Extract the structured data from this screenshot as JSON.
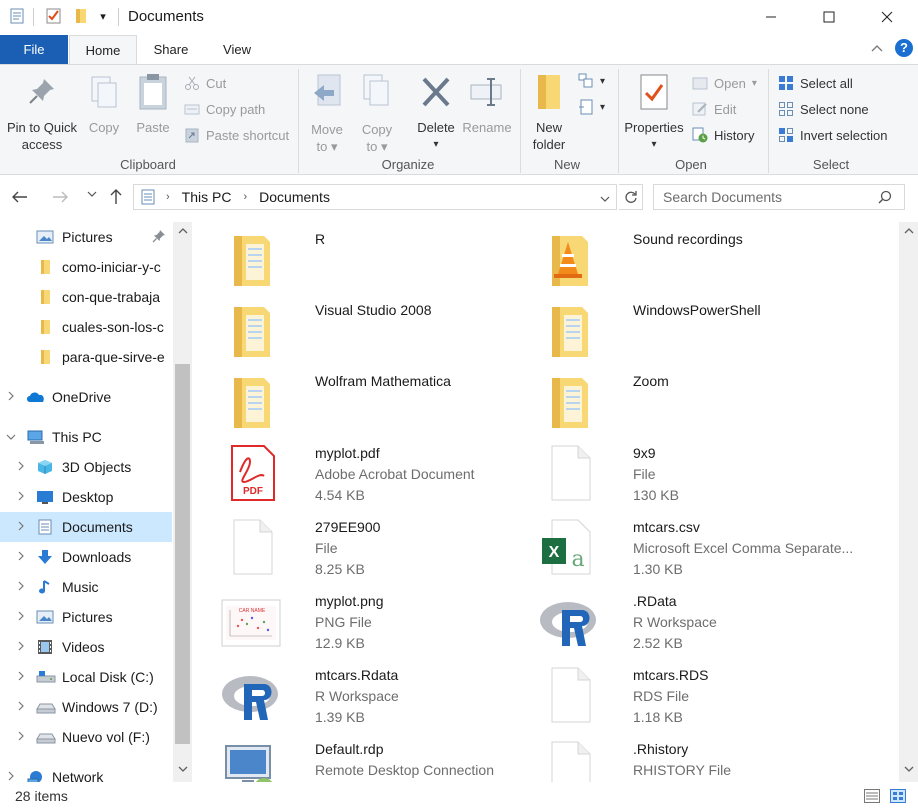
{
  "window": {
    "title": "Documents",
    "quick_access_dropdown": "▾"
  },
  "tabs": {
    "file": "File",
    "home": "Home",
    "share": "Share",
    "view": "View"
  },
  "ribbon": {
    "clipboard": {
      "label": "Clipboard",
      "pin": "Pin to Quick access",
      "pin_line1": "Pin to Quick",
      "pin_line2": "access",
      "copy": "Copy",
      "paste": "Paste",
      "cut": "Cut",
      "copy_path": "Copy path",
      "paste_shortcut": "Paste shortcut"
    },
    "organize": {
      "label": "Organize",
      "move_to_line1": "Move",
      "move_to_line2": "to",
      "copy_to_line1": "Copy",
      "copy_to_line2": "to",
      "delete": "Delete",
      "rename": "Rename"
    },
    "new": {
      "label": "New",
      "new_folder_line1": "New",
      "new_folder_line2": "folder"
    },
    "open": {
      "label": "Open",
      "properties": "Properties",
      "open": "Open",
      "edit": "Edit",
      "history": "History"
    },
    "select": {
      "label": "Select",
      "select_all": "Select all",
      "select_none": "Select none",
      "invert": "Invert selection"
    }
  },
  "address": {
    "crumbs": [
      "This PC",
      "Documents"
    ],
    "search_placeholder": "Search Documents"
  },
  "nav": {
    "items": [
      {
        "label": "Pictures",
        "icon": "pictures-icon",
        "pinned": true
      },
      {
        "label": "como-iniciar-y-c",
        "icon": "folder-icon"
      },
      {
        "label": "con-que-trabaja",
        "icon": "folder-icon"
      },
      {
        "label": "cuales-son-los-c",
        "icon": "folder-icon"
      },
      {
        "label": "para-que-sirve-e",
        "icon": "folder-icon"
      },
      {
        "label": "OneDrive",
        "icon": "onedrive-icon"
      },
      {
        "label": "This PC",
        "icon": "this-pc-icon"
      },
      {
        "label": "3D Objects",
        "icon": "3d-objects-icon"
      },
      {
        "label": "Desktop",
        "icon": "desktop-icon"
      },
      {
        "label": "Documents",
        "icon": "documents-icon",
        "selected": true
      },
      {
        "label": "Downloads",
        "icon": "downloads-icon"
      },
      {
        "label": "Music",
        "icon": "music-icon"
      },
      {
        "label": "Pictures",
        "icon": "pictures-icon"
      },
      {
        "label": "Videos",
        "icon": "videos-icon"
      },
      {
        "label": "Local Disk (C:)",
        "icon": "local-disk-icon"
      },
      {
        "label": "Windows 7 (D:)",
        "icon": "drive-icon"
      },
      {
        "label": "Nuevo vol (F:)",
        "icon": "drive-icon"
      },
      {
        "label": "Network",
        "icon": "network-icon"
      }
    ]
  },
  "files": [
    {
      "name": "R",
      "type": "",
      "size": "",
      "icon": "folder-icon"
    },
    {
      "name": "Sound recordings",
      "type": "",
      "size": "",
      "icon": "folder-vlc-icon"
    },
    {
      "name": "Visual Studio 2008",
      "type": "",
      "size": "",
      "icon": "folder-icon"
    },
    {
      "name": "WindowsPowerShell",
      "type": "",
      "size": "",
      "icon": "folder-icon"
    },
    {
      "name": "Wolfram Mathematica",
      "type": "",
      "size": "",
      "icon": "folder-icon"
    },
    {
      "name": "Zoom",
      "type": "",
      "size": "",
      "icon": "folder-icon"
    },
    {
      "name": "myplot.pdf",
      "type": "Adobe Acrobat Document",
      "size": "4.54 KB",
      "icon": "pdf-icon"
    },
    {
      "name": "9x9",
      "type": "File",
      "size": "130 KB",
      "icon": "blank-file-icon"
    },
    {
      "name": "279EE900",
      "type": "File",
      "size": "8.25 KB",
      "icon": "blank-file-icon"
    },
    {
      "name": "mtcars.csv",
      "type": "Microsoft Excel Comma Separate...",
      "size": "1.30 KB",
      "icon": "excel-csv-icon"
    },
    {
      "name": "myplot.png",
      "type": "PNG File",
      "size": "12.9 KB",
      "icon": "png-thumbnail-icon"
    },
    {
      "name": ".RData",
      "type": "R Workspace",
      "size": "2.52 KB",
      "icon": "r-logo-icon"
    },
    {
      "name": "mtcars.Rdata",
      "type": "R Workspace",
      "size": "1.39 KB",
      "icon": "r-logo-icon"
    },
    {
      "name": "mtcars.RDS",
      "type": "RDS File",
      "size": "1.18 KB",
      "icon": "blank-file-icon"
    },
    {
      "name": "Default.rdp",
      "type": "Remote Desktop Connection",
      "size": "",
      "icon": "rdp-icon"
    },
    {
      "name": ".Rhistory",
      "type": "RHISTORY File",
      "size": "",
      "icon": "blank-file-icon"
    }
  ],
  "status": {
    "item_count": "28 items"
  },
  "colors": {
    "accent": "#1a5fb4",
    "selection": "#cce8ff",
    "folder": "#f8d775"
  }
}
